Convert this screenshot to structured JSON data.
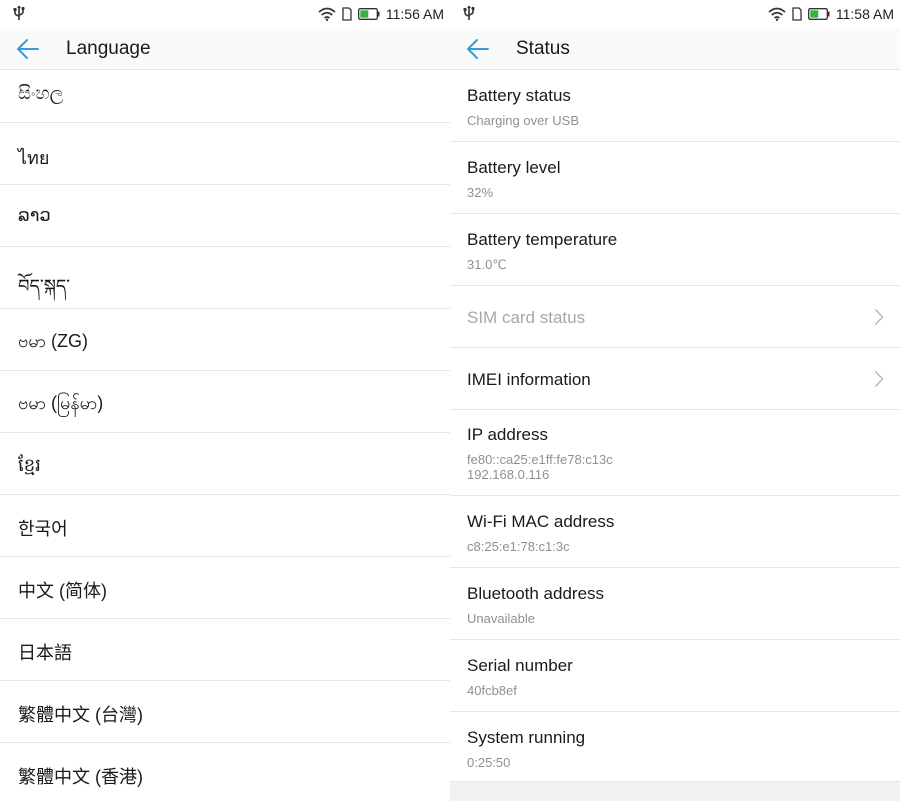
{
  "language_screen": {
    "status_bar": {
      "time": "11:56 AM"
    },
    "title": "Language",
    "languages": [
      "සිංහල",
      "ไทย",
      "ລາວ",
      "བོད་སྐད་",
      "ဗမာ (ZG)",
      "ဗမာ (မြန်မာ)",
      "ខ្មែរ",
      "한국어",
      "中文 (简体)",
      "日本語",
      "繁體中文 (台灣)",
      "繁體中文 (香港)"
    ]
  },
  "status_screen": {
    "status_bar": {
      "time": "11:58 AM"
    },
    "title": "Status",
    "items": {
      "battery_status": {
        "title": "Battery status",
        "value": "Charging over USB"
      },
      "battery_level": {
        "title": "Battery level",
        "value": "32%"
      },
      "battery_temperature": {
        "title": "Battery temperature",
        "value": "31.0℃"
      },
      "sim_card_status": {
        "title": "SIM card status"
      },
      "imei_information": {
        "title": "IMEI information"
      },
      "ip_address": {
        "title": "IP address",
        "value_line1": "fe80::ca25:e1ff:fe78:c13c",
        "value_line2": "192.168.0.116"
      },
      "wifi_mac_address": {
        "title": "Wi-Fi MAC address",
        "value": "c8:25:e1:78:c1:3c"
      },
      "bluetooth_address": {
        "title": "Bluetooth address",
        "value": "Unavailable"
      },
      "serial_number": {
        "title": "Serial number",
        "value": "40fcb8ef"
      },
      "system_running": {
        "title": "System running",
        "value": "0:25:50"
      }
    }
  },
  "colors": {
    "accent": "#3a9bdc",
    "battery_fill": "#35b24a",
    "disabled_text": "#a8a8a8"
  },
  "icons": [
    "usb-icon",
    "wifi-icon",
    "sim-card-icon",
    "battery-charging-icon",
    "back-arrow-icon",
    "chevron-right-icon"
  ]
}
